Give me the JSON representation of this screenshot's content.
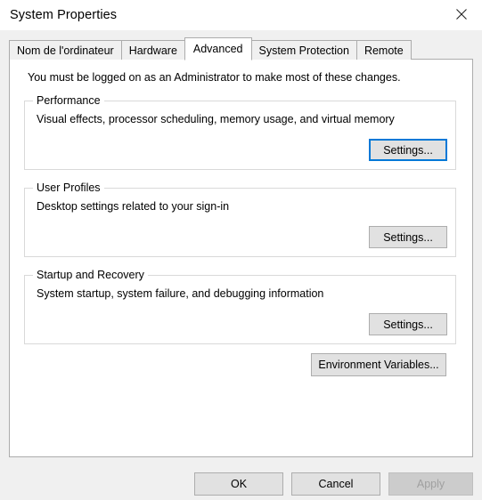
{
  "window": {
    "title": "System Properties",
    "close_label": "Close"
  },
  "tabs": [
    {
      "label": "Nom de l'ordinateur",
      "selected": false
    },
    {
      "label": "Hardware",
      "selected": false
    },
    {
      "label": "Advanced",
      "selected": true
    },
    {
      "label": "System Protection",
      "selected": false
    },
    {
      "label": "Remote",
      "selected": false
    }
  ],
  "content": {
    "admin_note": "You must be logged on as an Administrator to make most of these changes.",
    "groups": [
      {
        "title": "Performance",
        "description": "Visual effects, processor scheduling, memory usage, and virtual memory",
        "button_label": "Settings..."
      },
      {
        "title": "User Profiles",
        "description": "Desktop settings related to your sign-in",
        "button_label": "Settings..."
      },
      {
        "title": "Startup and Recovery",
        "description": "System startup, system failure, and debugging information",
        "button_label": "Settings..."
      }
    ],
    "environment_button_label": "Environment Variables..."
  },
  "footer": {
    "ok_label": "OK",
    "cancel_label": "Cancel",
    "apply_label": "Apply"
  },
  "colors": {
    "accent_focus": "#0078d7",
    "dialog_background": "#f0f0f0",
    "panel_background": "#ffffff",
    "button_face": "#e1e1e1",
    "button_border": "#adadad",
    "disabled_text": "#a0a0a0",
    "group_border": "#d9d9d9",
    "tab_border": "#acacac"
  }
}
